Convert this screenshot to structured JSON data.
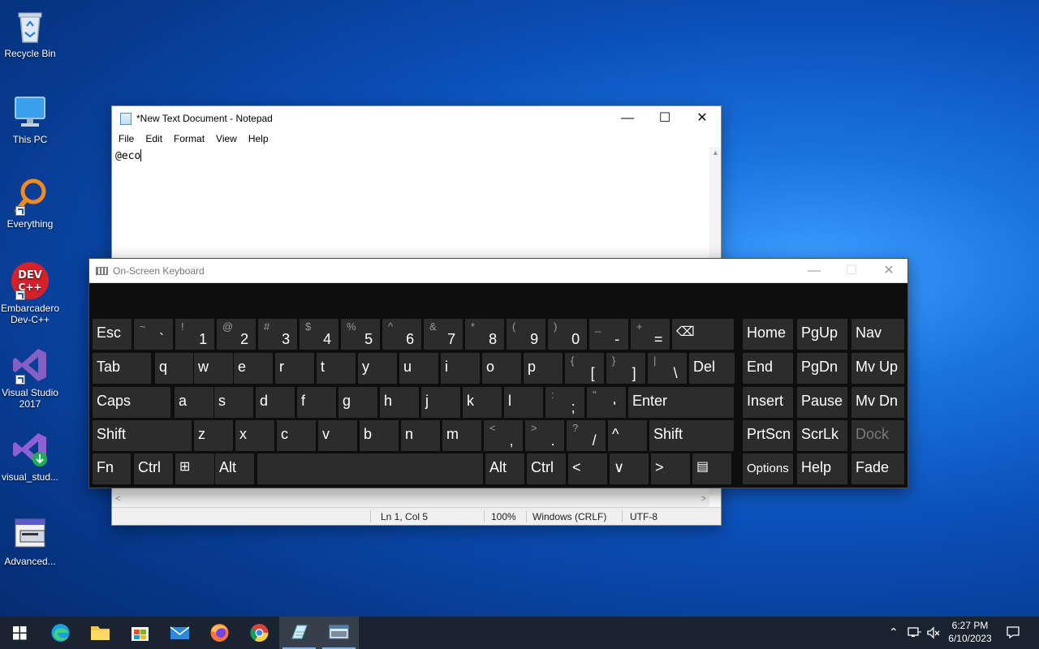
{
  "desktop": {
    "icons": [
      {
        "label": "Recycle Bin"
      },
      {
        "label": "This PC"
      },
      {
        "label": "Everything"
      },
      {
        "label": "Embarcadero Dev-C++"
      },
      {
        "label": "Visual Studio 2017"
      },
      {
        "label": "visual_stud..."
      },
      {
        "label": "Advanced..."
      }
    ]
  },
  "notepad": {
    "title": "*New Text Document - Notepad",
    "menu": [
      "File",
      "Edit",
      "Format",
      "View",
      "Help"
    ],
    "content": "@eco",
    "status": {
      "position": "Ln 1, Col 5",
      "zoom": "100%",
      "line_endings": "Windows (CRLF)",
      "encoding": "UTF-8"
    }
  },
  "osk": {
    "title": "On-Screen Keyboard",
    "rows": [
      [
        {
          "l": "Esc"
        },
        {
          "t": "~",
          "b": "`"
        },
        {
          "t": "!",
          "b": "1"
        },
        {
          "t": "@",
          "b": "2"
        },
        {
          "t": "#",
          "b": "3"
        },
        {
          "t": "$",
          "b": "4"
        },
        {
          "t": "%",
          "b": "5"
        },
        {
          "t": "^",
          "b": "6"
        },
        {
          "t": "&",
          "b": "7"
        },
        {
          "t": "*",
          "b": "8"
        },
        {
          "t": "(",
          "b": "9"
        },
        {
          "t": ")",
          "b": "0"
        },
        {
          "t": "_",
          "b": "-"
        },
        {
          "t": "+",
          "b": "="
        },
        {
          "l": "⌫"
        },
        {
          "l": "Home"
        },
        {
          "l": "PgUp"
        },
        {
          "l": "Nav"
        }
      ],
      [
        {
          "l": "Tab"
        },
        {
          "l": "q"
        },
        {
          "l": "w"
        },
        {
          "l": "e"
        },
        {
          "l": "r"
        },
        {
          "l": "t"
        },
        {
          "l": "y"
        },
        {
          "l": "u"
        },
        {
          "l": "i"
        },
        {
          "l": "o"
        },
        {
          "l": "p"
        },
        {
          "t": "{",
          "b": "["
        },
        {
          "t": "}",
          "b": "]"
        },
        {
          "t": "|",
          "b": "\\"
        },
        {
          "l": "Del"
        },
        {
          "l": "End"
        },
        {
          "l": "PgDn"
        },
        {
          "l": "Mv Up"
        }
      ],
      [
        {
          "l": "Caps"
        },
        {
          "l": "a"
        },
        {
          "l": "s"
        },
        {
          "l": "d"
        },
        {
          "l": "f"
        },
        {
          "l": "g"
        },
        {
          "l": "h"
        },
        {
          "l": "j"
        },
        {
          "l": "k"
        },
        {
          "l": "l"
        },
        {
          "t": ":",
          "b": ";"
        },
        {
          "t": "\"",
          "b": "'"
        },
        {
          "l": "Enter"
        },
        {
          "l": "Insert"
        },
        {
          "l": "Pause"
        },
        {
          "l": "Mv Dn"
        }
      ],
      [
        {
          "l": "Shift"
        },
        {
          "l": "z"
        },
        {
          "l": "x"
        },
        {
          "l": "c"
        },
        {
          "l": "v"
        },
        {
          "l": "b"
        },
        {
          "l": "n"
        },
        {
          "l": "m"
        },
        {
          "t": "<",
          "b": ","
        },
        {
          "t": ">",
          "b": "."
        },
        {
          "t": "?",
          "b": "/"
        },
        {
          "l": "^"
        },
        {
          "l": "Shift"
        },
        {
          "l": "PrtScn"
        },
        {
          "l": "ScrLk"
        },
        {
          "l": "Dock"
        }
      ],
      [
        {
          "l": "Fn"
        },
        {
          "l": "Ctrl"
        },
        {
          "l": "⊞"
        },
        {
          "l": "Alt"
        },
        {
          "l": ""
        },
        {
          "l": "Alt"
        },
        {
          "l": "Ctrl"
        },
        {
          "l": "<"
        },
        {
          "l": "∨"
        },
        {
          "l": ">"
        },
        {
          "l": "▤"
        },
        {
          "l": "Options"
        },
        {
          "l": "Help"
        },
        {
          "l": "Fade"
        }
      ]
    ]
  },
  "taskbar": {
    "apps": [
      "start",
      "edge",
      "file-explorer",
      "microsoft-store",
      "mail",
      "firefox",
      "chrome",
      "notepad",
      "on-screen-keyboard"
    ],
    "time": "6:27 PM",
    "date": "6/10/2023"
  }
}
